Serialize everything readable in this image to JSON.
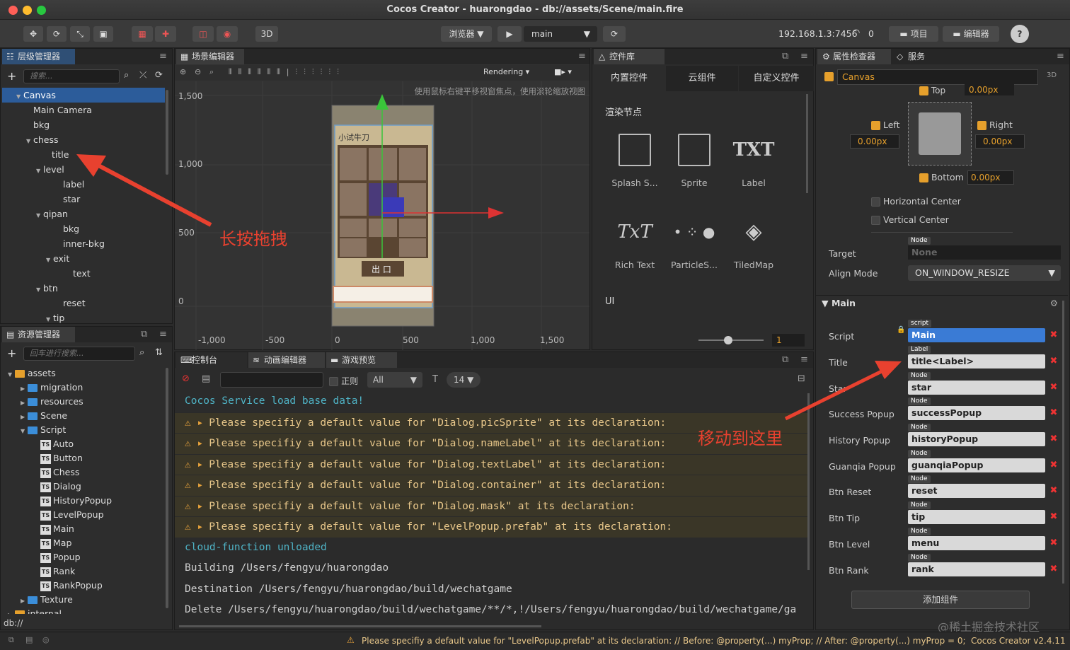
{
  "window": {
    "title": "Cocos Creator - huarongdao - db://assets/Scene/main.fire"
  },
  "toolbar": {
    "btn_3d": "3D",
    "browser": "浏览器 ▼",
    "scene_select": "main",
    "ip": "192.168.1.3:7456",
    "conn_count": "0",
    "project": "项目",
    "editor": "编辑器",
    "help": "?"
  },
  "hierarchy": {
    "tab": "层级管理器",
    "search_placeholder": "搜索...",
    "nodes": [
      {
        "label": "Canvas",
        "tri": "▼"
      },
      {
        "label": "Main Camera",
        "tri": ""
      },
      {
        "label": "bkg",
        "tri": ""
      },
      {
        "label": "chess",
        "tri": "▼"
      },
      {
        "label": "title",
        "tri": ""
      },
      {
        "label": "level",
        "tri": "▼"
      },
      {
        "label": "label",
        "tri": ""
      },
      {
        "label": "star",
        "tri": ""
      },
      {
        "label": "qipan",
        "tri": "▼"
      },
      {
        "label": "bkg",
        "tri": ""
      },
      {
        "label": "inner-bkg",
        "tri": ""
      },
      {
        "label": "exit",
        "tri": "▼"
      },
      {
        "label": "text",
        "tri": ""
      },
      {
        "label": "btn",
        "tri": "▼"
      },
      {
        "label": "reset",
        "tri": ""
      },
      {
        "label": "tip",
        "tri": "▼"
      }
    ]
  },
  "assets": {
    "tab": "资源管理器",
    "search_placeholder": "回车进行搜索...",
    "footer": "db://",
    "items": [
      {
        "label": "assets",
        "tri": "▼"
      },
      {
        "label": "migration",
        "tri": "▶"
      },
      {
        "label": "resources",
        "tri": "▶"
      },
      {
        "label": "Scene",
        "tri": "▶"
      },
      {
        "label": "Script",
        "tri": "▼"
      },
      {
        "label": "Auto",
        "tri": ""
      },
      {
        "label": "Button",
        "tri": ""
      },
      {
        "label": "Chess",
        "tri": ""
      },
      {
        "label": "Dialog",
        "tri": ""
      },
      {
        "label": "HistoryPopup",
        "tri": ""
      },
      {
        "label": "LevelPopup",
        "tri": ""
      },
      {
        "label": "Main",
        "tri": ""
      },
      {
        "label": "Map",
        "tri": ""
      },
      {
        "label": "Popup",
        "tri": ""
      },
      {
        "label": "Rank",
        "tri": ""
      },
      {
        "label": "RankPopup",
        "tri": ""
      },
      {
        "label": "Texture",
        "tri": "▶"
      },
      {
        "label": "internal",
        "tri": "▶"
      }
    ]
  },
  "scene": {
    "tab": "场景编辑器",
    "rendering": "Rendering",
    "hint": "使用鼠标右键平移视窗焦点，使用滚轮缩放视图",
    "y_ticks": [
      "1,500",
      "1,000",
      "500",
      "0"
    ],
    "x_ticks": [
      "-1,000",
      "-500",
      "0",
      "500",
      "1,000",
      "1,500"
    ],
    "game_title": "小试牛刀",
    "game_btn": "出 口"
  },
  "annotations": {
    "drag": "长按拖拽",
    "move": "移动到这里"
  },
  "widgets": {
    "tab": "控件库",
    "tabs": [
      "内置控件",
      "云组件",
      "自定义控件"
    ],
    "section_render": "渲染节点",
    "section_ui": "UI",
    "items": [
      {
        "label": "Splash S...",
        "icon": "image-icon"
      },
      {
        "label": "Sprite",
        "icon": "image-icon"
      },
      {
        "label": "Label",
        "icon": "TXT"
      },
      {
        "label": "Rich Text",
        "icon": "TxT"
      },
      {
        "label": "ParticleS...",
        "icon": "particle-icon"
      },
      {
        "label": "TiledMap",
        "icon": "tiledmap-icon"
      }
    ],
    "zoom_value": "1"
  },
  "console": {
    "tabs": [
      "控制台",
      "动画编辑器",
      "游戏预览"
    ],
    "regex_label": "正则",
    "filter": "All",
    "font_size": "14",
    "lines": [
      {
        "type": "info",
        "text": "Cocos Service load base data!"
      },
      {
        "type": "warn",
        "text": "Please specifiy a default value for \"Dialog.picSprite\" at its declaration:"
      },
      {
        "type": "warn",
        "text": "Please specifiy a default value for \"Dialog.nameLabel\" at its declaration:"
      },
      {
        "type": "warn",
        "text": "Please specifiy a default value for \"Dialog.textLabel\" at its declaration:"
      },
      {
        "type": "warn",
        "text": "Please specifiy a default value for \"Dialog.container\" at its declaration:"
      },
      {
        "type": "warn",
        "text": "Please specifiy a default value for \"Dialog.mask\" at its declaration:"
      },
      {
        "type": "warn",
        "text": "Please specifiy a default value for \"LevelPopup.prefab\" at its declaration:"
      },
      {
        "type": "info",
        "text": "cloud-function unloaded"
      },
      {
        "type": "log",
        "text": "Building /Users/fengyu/huarongdao"
      },
      {
        "type": "log",
        "text": "Destination /Users/fengyu/huarongdao/build/wechatgame"
      },
      {
        "type": "log",
        "text": "Delete /Users/fengyu/huarongdao/build/wechatgame/**/*,!/Users/fengyu/huarongdao/build/wechatgame/ga"
      }
    ]
  },
  "inspector": {
    "tabs": [
      "属性检查器",
      "服务"
    ],
    "node_name": "Canvas",
    "label_3d": "3D",
    "widget": {
      "top": "Top",
      "top_val": "0.00px",
      "left": "Left",
      "left_val": "0.00px",
      "right": "Right",
      "right_val": "0.00px",
      "bottom": "Bottom",
      "bottom_val": "0.00px",
      "hcenter": "Horizontal Center",
      "vcenter": "Vertical Center",
      "target": "Target",
      "target_tag": "Node",
      "target_val": "None",
      "align_mode": "Align Mode",
      "align_val": "ON_WINDOW_RESIZE"
    },
    "main_section": "Main",
    "props": [
      {
        "label": "Script",
        "tag": "script",
        "value": "Main"
      },
      {
        "label": "Title",
        "tag": "Label",
        "value": "title<Label>"
      },
      {
        "label": "Star",
        "tag": "Node",
        "value": "star"
      },
      {
        "label": "Success Popup",
        "tag": "Node",
        "value": "successPopup"
      },
      {
        "label": "History Popup",
        "tag": "Node",
        "value": "historyPopup"
      },
      {
        "label": "Guanqia Popup",
        "tag": "Node",
        "value": "guanqiaPopup"
      },
      {
        "label": "Btn Reset",
        "tag": "Node",
        "value": "reset"
      },
      {
        "label": "Btn Tip",
        "tag": "Node",
        "value": "tip"
      },
      {
        "label": "Btn Level",
        "tag": "Node",
        "value": "menu"
      },
      {
        "label": "Btn Rank",
        "tag": "Node",
        "value": "rank"
      }
    ],
    "add_component": "添加组件",
    "watermark": "@稀土掘金技术社区"
  },
  "statusbar": {
    "message": "Please specifiy a default value for \"LevelPopup.prefab\" at its declaration: // Before: @property(...) myProp; // After: @property(...) myProp = 0;",
    "version": "Cocos Creator v2.4.11"
  },
  "colors": {
    "accent": "#2c5c9a",
    "warning": "#e8a33c",
    "arrow": "#e8412f"
  }
}
